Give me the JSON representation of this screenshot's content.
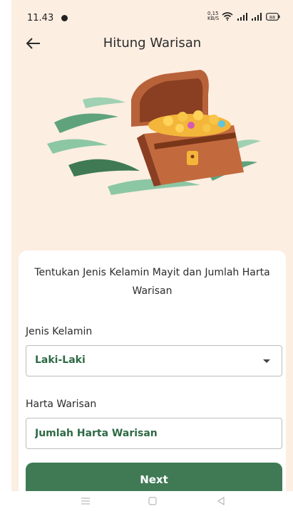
{
  "status_bar": {
    "time": "11.43",
    "net_speed_top": "0,15",
    "net_speed_bottom": "KB/S",
    "battery": "88"
  },
  "app_bar": {
    "title": "Hitung Warisan"
  },
  "icons": {
    "back": "arrow-left-icon",
    "illustration": "treasure-chest-illustration",
    "dropdown": "caret-down-icon"
  },
  "card": {
    "heading": "Tentukan Jenis Kelamin Mayit dan Jumlah Harta Warisan",
    "gender_label": "Jenis Kelamin",
    "gender_value": "Laki-Laki",
    "estate_label": "Harta Warisan",
    "estate_placeholder": "Jumlah Harta Warisan",
    "next_label": "Next"
  },
  "colors": {
    "background": "#fdeee2",
    "primary_green": "#3f7a55",
    "field_text_green": "#2e6a45"
  }
}
